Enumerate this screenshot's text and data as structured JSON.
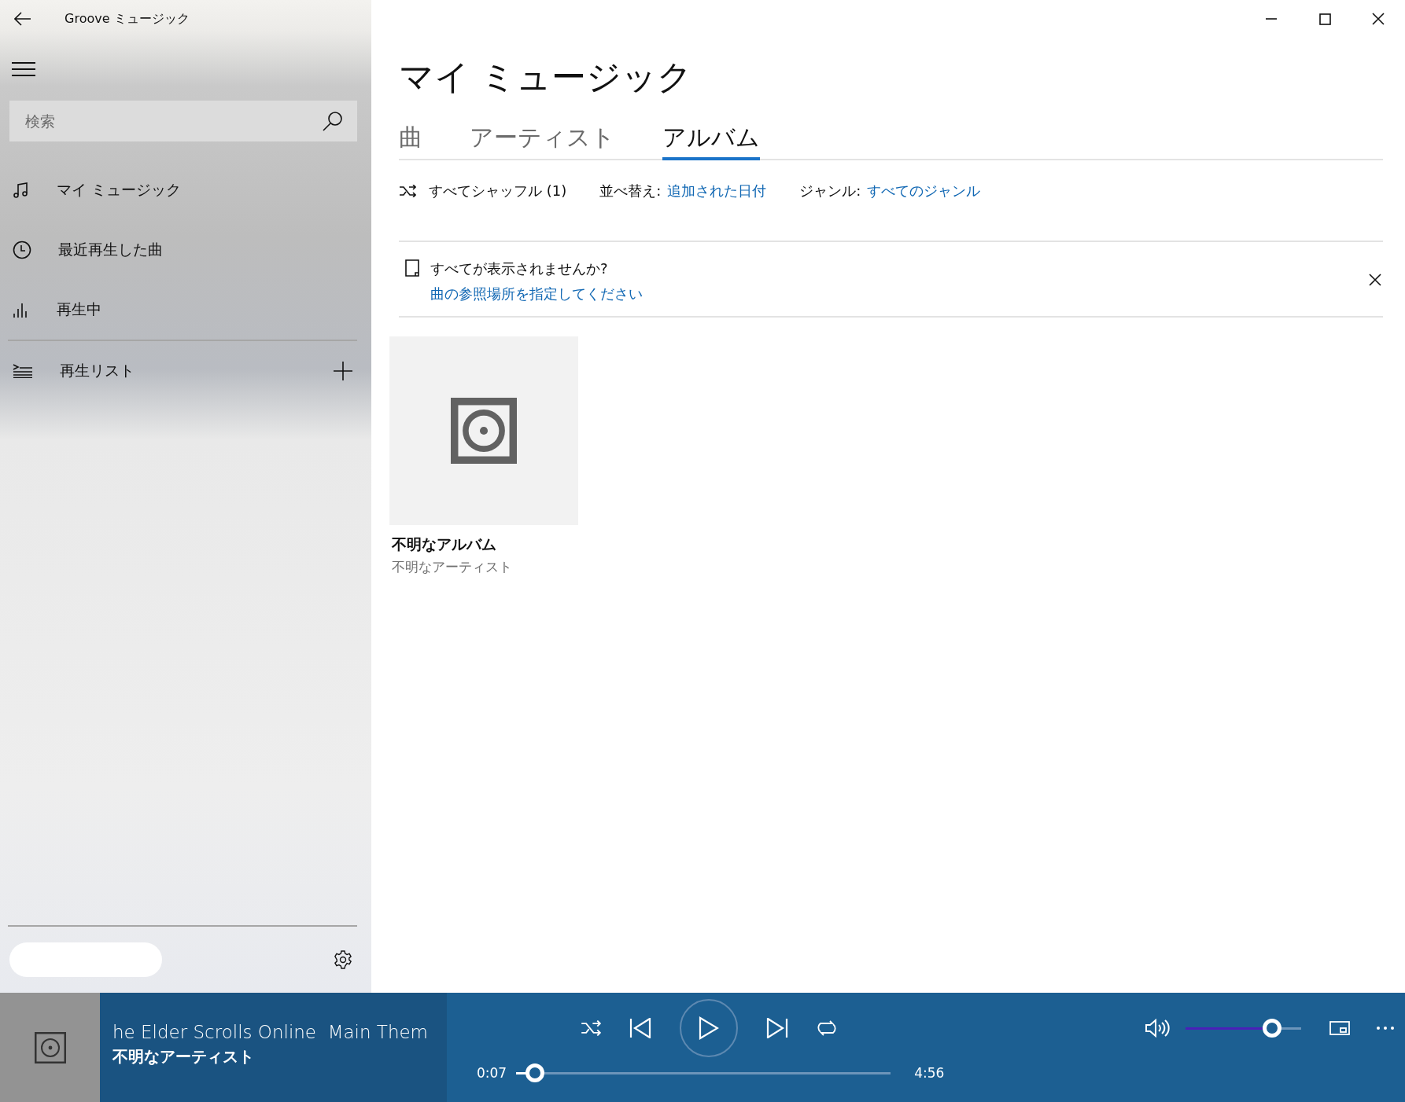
{
  "app": {
    "title": "Groove ミュージック"
  },
  "sidebar": {
    "search": {
      "placeholder": "検索"
    },
    "nav_items": [
      {
        "label": "マイ ミュージック",
        "kind": "music"
      },
      {
        "label": "最近再生した曲",
        "kind": "recent"
      },
      {
        "label": "再生中",
        "kind": "nowplaying"
      }
    ],
    "playlists": {
      "label": "再生リスト"
    }
  },
  "main": {
    "title": "マイ ミュージック",
    "tabs": [
      {
        "label": "曲",
        "selected": false
      },
      {
        "label": "アーティスト",
        "selected": false
      },
      {
        "label": "アルバム",
        "selected": true
      }
    ],
    "filters": {
      "shuffle": "すべてシャッフル (1)",
      "sort_label": "並べ替え:",
      "sort_value": "追加された日付",
      "genre_label": "ジャンル:",
      "genre_value": "すべてのジャンル"
    },
    "notice": {
      "text": "すべてが表示されませんか?",
      "link": "曲の参照場所を指定してください"
    },
    "albums": [
      {
        "title": "不明なアルバム",
        "artist": "不明なアーティスト"
      }
    ]
  },
  "player": {
    "title": "he Elder Scrolls Online  Main Them",
    "artist": "不明なアーティスト",
    "elapsed": "0:07",
    "duration": "4:56",
    "progress": {
      "level": 0.05
    },
    "volume": {
      "level": 0.75
    }
  }
}
